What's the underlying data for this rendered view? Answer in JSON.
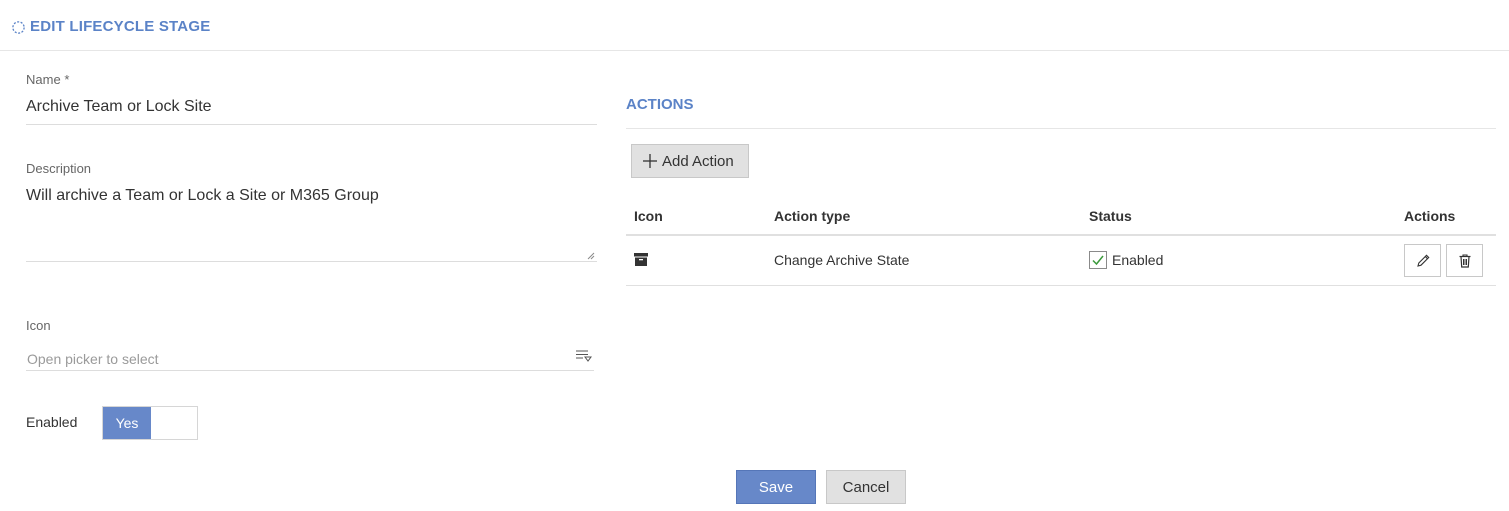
{
  "header": {
    "title": "EDIT LIFECYCLE STAGE",
    "icon": "loading-circle-icon",
    "accent_color": "#5b83c7"
  },
  "form": {
    "name": {
      "label": "Name",
      "required_marker": "*",
      "value": "Archive Team or Lock Site"
    },
    "description": {
      "label": "Description",
      "value": "Will archive a Team or Lock a Site or M365 Group"
    },
    "icon": {
      "label": "Icon",
      "placeholder": "Open picker to select",
      "picker_icon": "filter-list-icon"
    },
    "enabled": {
      "label": "Enabled",
      "toggle_label": "Yes",
      "on": true,
      "on_color": "#6788c9"
    }
  },
  "actions_panel": {
    "title": "ACTIONS",
    "add_button_label": "Add Action",
    "columns": [
      "Icon",
      "Action type",
      "Status",
      "Actions"
    ],
    "rows": [
      {
        "icon": "archive-box-icon",
        "action_type": "Change Archive State",
        "status": "Enabled",
        "status_checked": true
      }
    ],
    "row_action_icons": [
      "pencil-edit-icon",
      "trash-delete-icon"
    ]
  },
  "footer": {
    "save_label": "Save",
    "cancel_label": "Cancel"
  }
}
